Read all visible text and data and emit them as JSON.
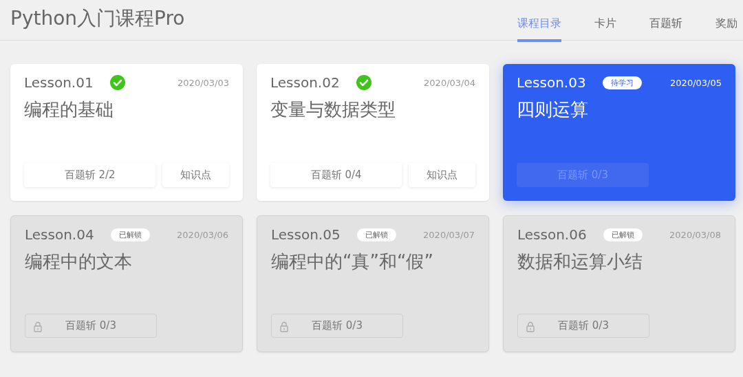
{
  "app_title": "Python入门课程Pro",
  "tabs": [
    {
      "label": "课程目录",
      "selected": true
    },
    {
      "label": "卡片",
      "selected": false
    },
    {
      "label": "百题斩",
      "selected": false
    },
    {
      "label": "奖励",
      "selected": false
    }
  ],
  "lessons": [
    {
      "lesson": "Lesson.01",
      "kind": "done",
      "date": "2020/03/03",
      "title": "编程的基础",
      "buttons": [
        {
          "label": "百题斩 2/2",
          "kind": "wide"
        },
        {
          "label": "知识点",
          "kind": "narrow"
        }
      ]
    },
    {
      "lesson": "Lesson.02",
      "kind": "done",
      "date": "2020/03/04",
      "title": "变量与数据类型",
      "buttons": [
        {
          "label": "百题斩 0/4",
          "kind": "wide"
        },
        {
          "label": "知识点",
          "kind": "narrow"
        }
      ]
    },
    {
      "lesson": "Lesson.03",
      "kind": "current",
      "badge": "待学习",
      "date": "2020/03/05",
      "title": "四则运算",
      "buttons": [
        {
          "label": "百题斩 0/3",
          "kind": "wide"
        }
      ]
    },
    {
      "lesson": "Lesson.04",
      "kind": "locked",
      "badge": "已解锁",
      "date": "2020/03/06",
      "title": "编程中的文本",
      "buttons": [
        {
          "label": "百题斩 0/3",
          "kind": "wide"
        }
      ]
    },
    {
      "lesson": "Lesson.05",
      "kind": "locked",
      "badge": "已解锁",
      "date": "2020/03/07",
      "title": "编程中的“真”和“假”",
      "buttons": [
        {
          "label": "百题斩 0/3",
          "kind": "wide"
        }
      ]
    },
    {
      "lesson": "Lesson.06",
      "kind": "locked",
      "badge": "已解锁",
      "date": "2020/03/08",
      "title": "数据和运算小结",
      "buttons": [
        {
          "label": "百题斩 0/3",
          "kind": "wide"
        }
      ]
    }
  ]
}
